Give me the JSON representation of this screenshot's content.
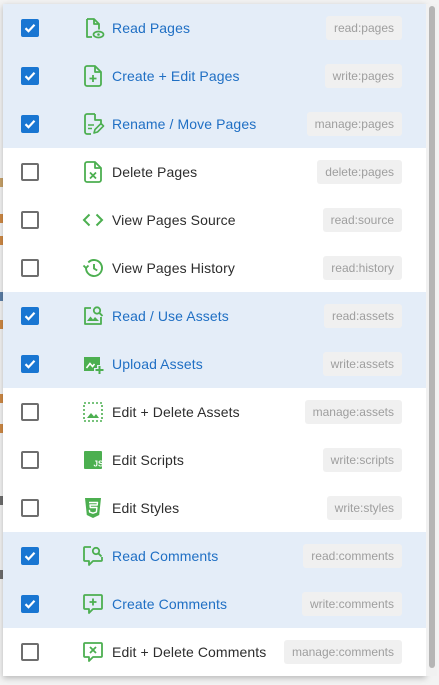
{
  "permissions": [
    {
      "label": "Read Pages",
      "scope": "read:pages",
      "checked": true,
      "icon": "file-eye-icon"
    },
    {
      "label": "Create + Edit Pages",
      "scope": "write:pages",
      "checked": true,
      "icon": "file-plus-icon"
    },
    {
      "label": "Rename / Move Pages",
      "scope": "manage:pages",
      "checked": true,
      "icon": "file-edit-icon"
    },
    {
      "label": "Delete Pages",
      "scope": "delete:pages",
      "checked": false,
      "icon": "file-remove-icon"
    },
    {
      "label": "View Pages Source",
      "scope": "read:source",
      "checked": false,
      "icon": "code-brackets-icon"
    },
    {
      "label": "View Pages History",
      "scope": "read:history",
      "checked": false,
      "icon": "history-icon"
    },
    {
      "label": "Read / Use Assets",
      "scope": "read:assets",
      "checked": true,
      "icon": "image-search-icon"
    },
    {
      "label": "Upload Assets",
      "scope": "write:assets",
      "checked": true,
      "icon": "image-plus-icon"
    },
    {
      "label": "Edit + Delete Assets",
      "scope": "manage:assets",
      "checked": false,
      "icon": "image-frame-icon"
    },
    {
      "label": "Edit Scripts",
      "scope": "write:scripts",
      "checked": false,
      "icon": "javascript-icon"
    },
    {
      "label": "Edit Styles",
      "scope": "write:styles",
      "checked": false,
      "icon": "css3-icon"
    },
    {
      "label": "Read Comments",
      "scope": "read:comments",
      "checked": true,
      "icon": "comment-search-icon"
    },
    {
      "label": "Create Comments",
      "scope": "write:comments",
      "checked": true,
      "icon": "comment-plus-icon"
    },
    {
      "label": "Edit + Delete Comments",
      "scope": "manage:comments",
      "checked": false,
      "icon": "comment-remove-icon"
    }
  ],
  "colors": {
    "accent": "#1976d2",
    "icon_green": "#4caf50",
    "selected_row": "#e4edf8",
    "selected_text": "#1f6fc4"
  }
}
